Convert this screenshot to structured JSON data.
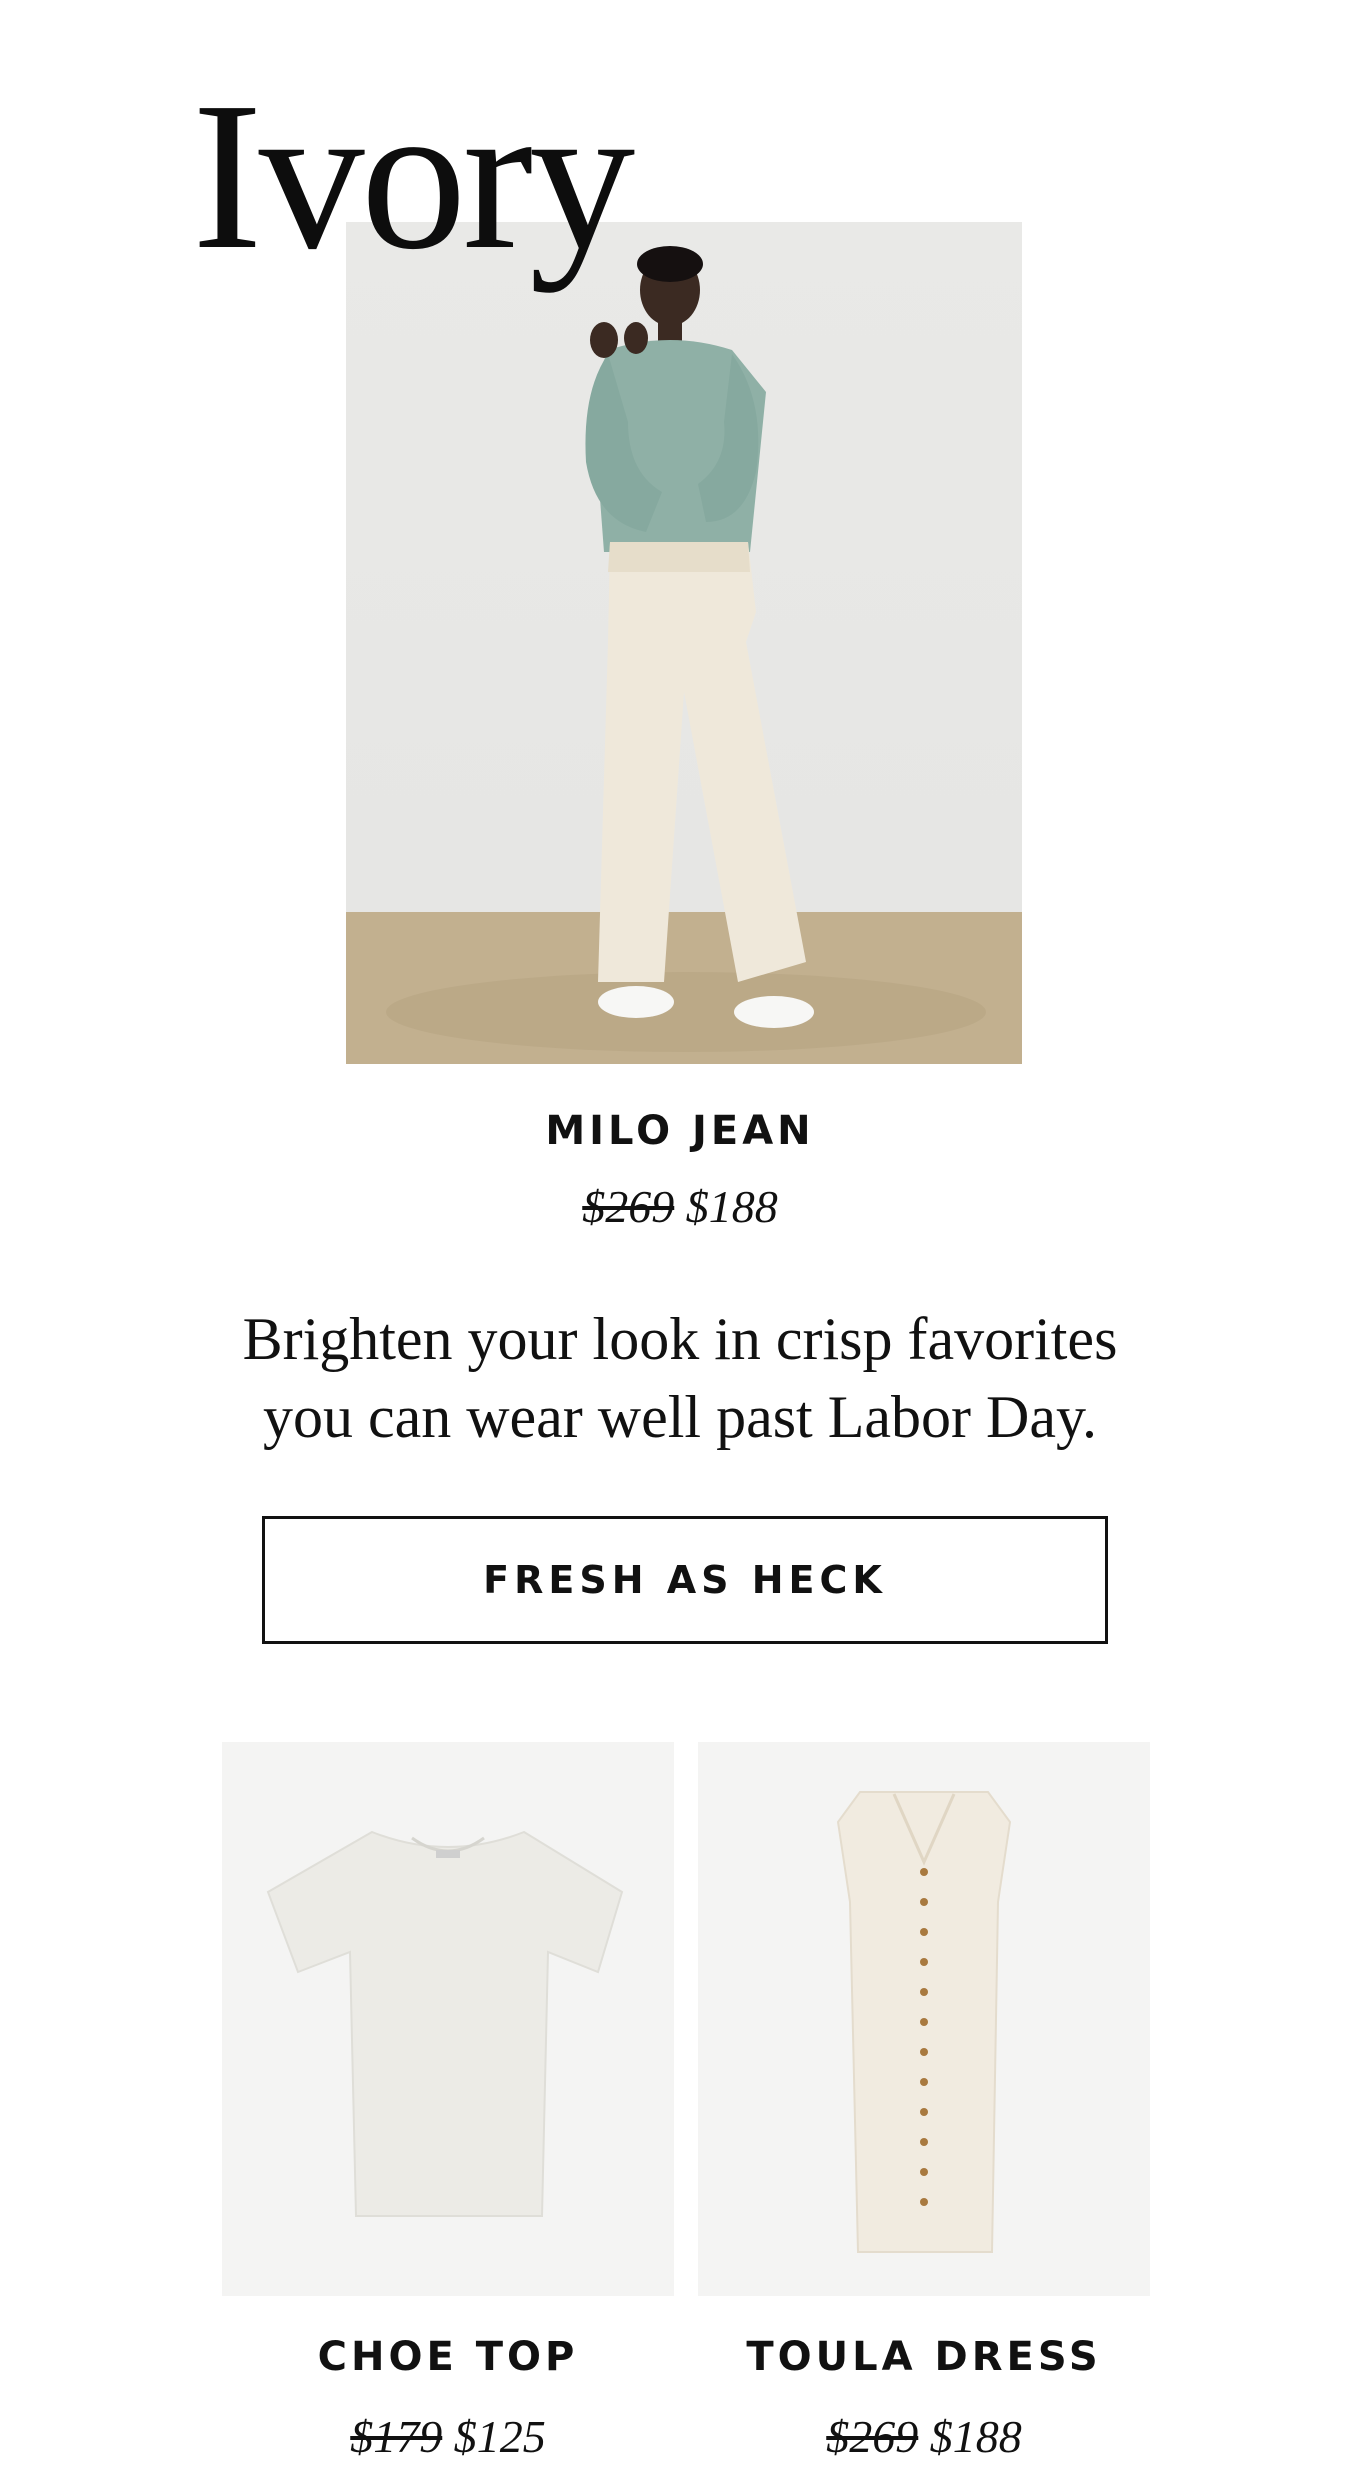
{
  "hero": {
    "title": "Ivory",
    "product_name": "MILO JEAN",
    "old_price": "$269",
    "new_price": "$188"
  },
  "body_text": {
    "line1": "Brighten your look in crisp favorites",
    "line2": "you can wear well past Labor Day."
  },
  "cta": {
    "label": "FRESH AS HECK"
  },
  "products": [
    {
      "name": "CHOE TOP",
      "old_price": "$179",
      "new_price": "$125"
    },
    {
      "name": "TOULA DRESS",
      "old_price": "$269",
      "new_price": "$188"
    }
  ],
  "colors": {
    "background": "#ffffff",
    "text": "#111111",
    "tile_background": "#f4f4f3",
    "garment_ivory": "#efe8da",
    "sweater_teal": "#8fb0a6",
    "floor_tan": "#c2b08f"
  },
  "icons": {
    "hero_image": "model-in-ivory-jeans-photo",
    "top_image": "ivory-tshirt-photo",
    "dress_image": "ivory-button-dress-photo"
  }
}
